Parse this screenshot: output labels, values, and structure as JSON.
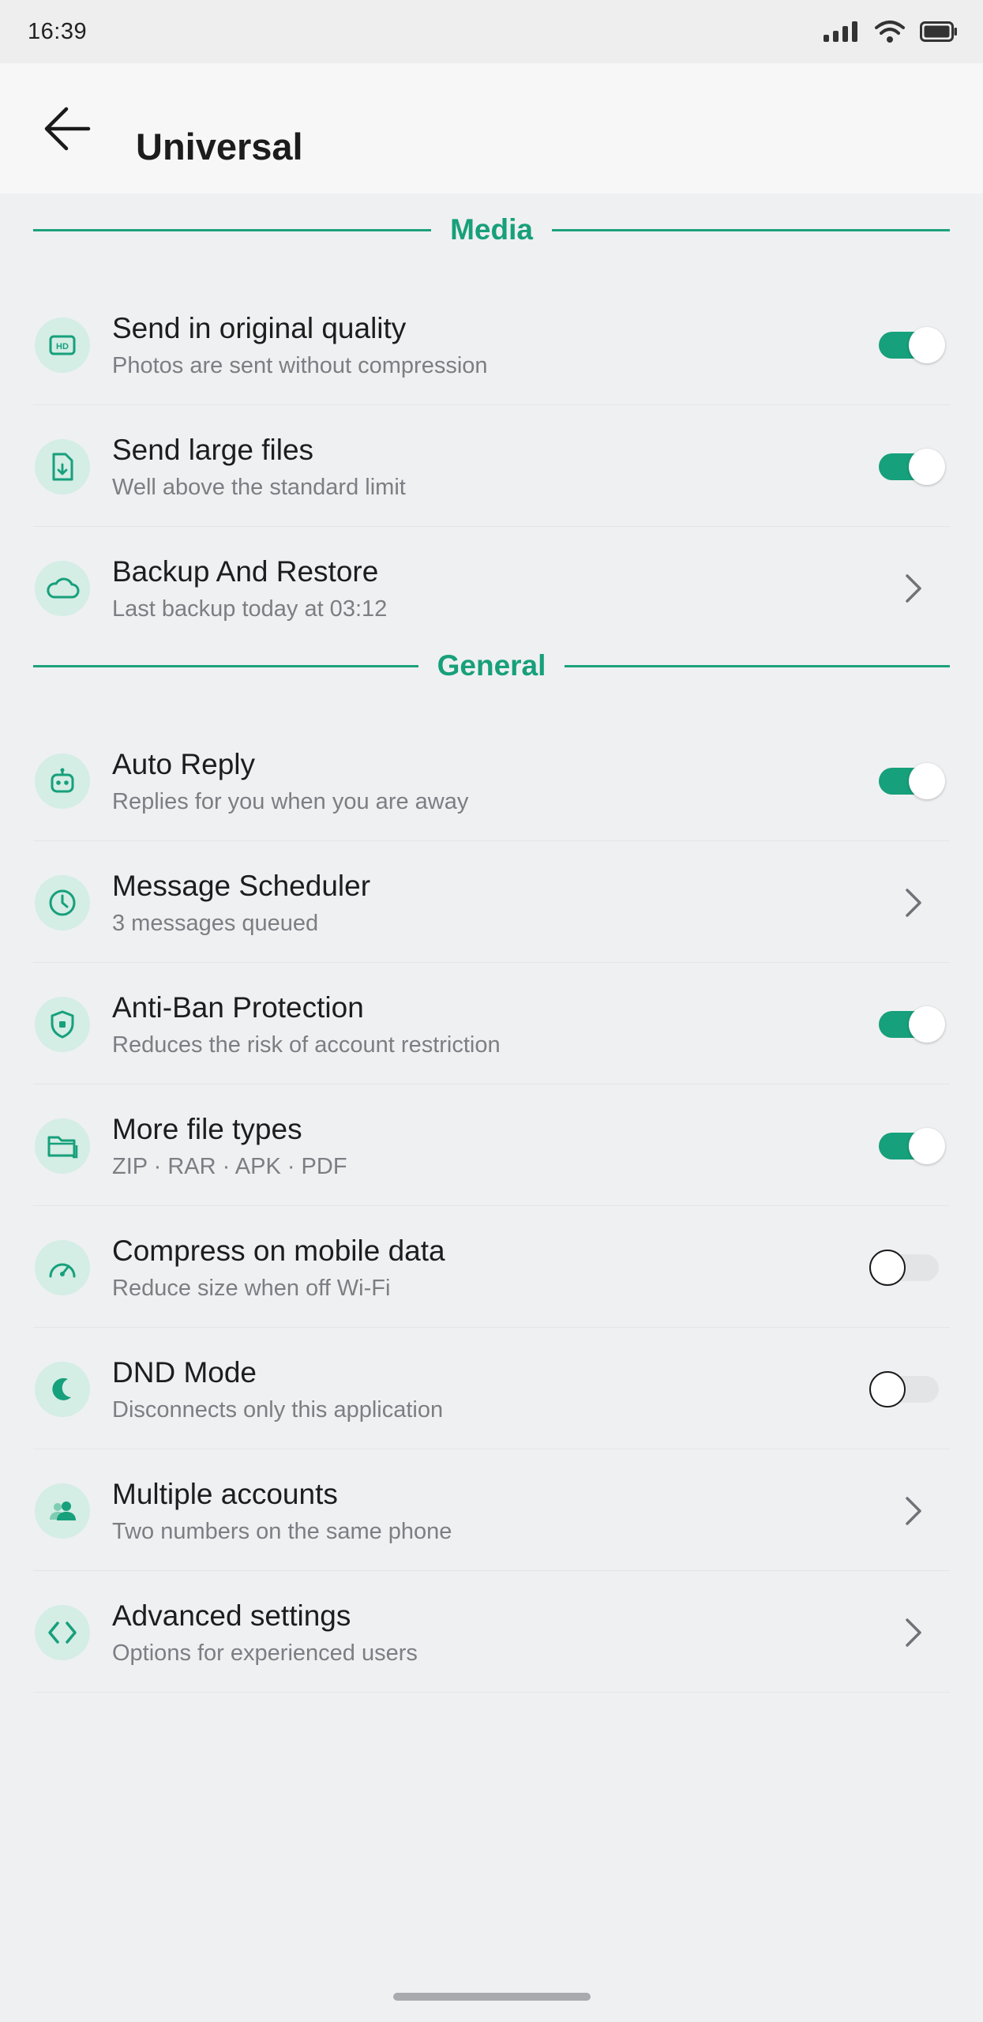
{
  "status_bar": {
    "time": "16:39"
  },
  "header": {
    "title": "Universal"
  },
  "colors": {
    "accent": "#16a07b",
    "icon_bg": "#d4ede5",
    "background": "#eff0f2"
  },
  "sections": {
    "media": {
      "label": "Media",
      "items": [
        {
          "title": "Send in original quality",
          "subtitle": "Photos are sent without compression",
          "icon": "hd-icon",
          "control": "toggle",
          "on": true
        },
        {
          "title": "Send large files",
          "subtitle": "Well above the standard limit",
          "icon": "file-download-icon",
          "control": "toggle",
          "on": true
        },
        {
          "title": "Backup And Restore",
          "subtitle": "Last backup today at 03:12",
          "icon": "cloud-icon",
          "control": "chevron"
        }
      ]
    },
    "general": {
      "label": "General",
      "items": [
        {
          "title": "Auto Reply",
          "subtitle": "Replies for you when you are away",
          "icon": "robot-icon",
          "control": "toggle",
          "on": true
        },
        {
          "title": "Message Scheduler",
          "subtitle": "3 messages queued",
          "icon": "clock-icon",
          "control": "chevron"
        },
        {
          "title": "Anti-Ban Protection",
          "subtitle": "Reduces the risk of account restriction",
          "icon": "shield-icon",
          "control": "toggle",
          "on": true
        },
        {
          "title": "More file types",
          "subtitle": "ZIP · RAR · APK · PDF",
          "icon": "folder-icon",
          "control": "toggle",
          "on": true
        },
        {
          "title": "Compress on mobile data",
          "subtitle": "Reduce size when off Wi-Fi",
          "icon": "speedometer-icon",
          "control": "toggle",
          "on": false
        },
        {
          "title": "DND Mode",
          "subtitle": "Disconnects only this application",
          "icon": "moon-icon",
          "control": "toggle",
          "on": false
        },
        {
          "title": "Multiple accounts",
          "subtitle": "Two numbers on the same phone",
          "icon": "people-icon",
          "control": "chevron"
        },
        {
          "title": "Advanced settings",
          "subtitle": "Options for experienced users",
          "icon": "code-icon",
          "control": "chevron"
        }
      ]
    }
  }
}
